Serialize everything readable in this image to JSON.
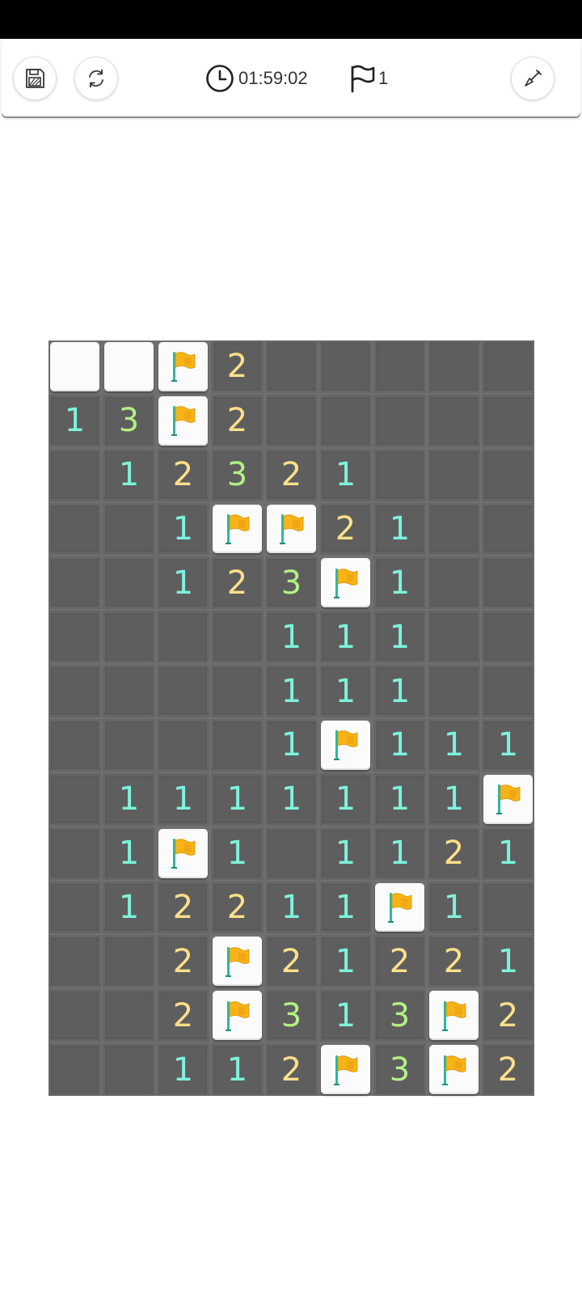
{
  "toolbar": {
    "save_icon": "save-icon",
    "restart_icon": "restart-icon",
    "timer_icon": "clock-icon",
    "timer": "01:59:02",
    "flag_icon": "flag-icon",
    "flag_count": "1",
    "dig_icon": "shovel-icon"
  },
  "colors": {
    "n1": "#7ef3dd",
    "n2": "#ffe08a",
    "n3": "#b4f184",
    "flag": "#f7b318",
    "flag_pole": "#2bb8a0",
    "open_cell": "#5e5e5e",
    "hidden_cell": "#fbfbfb"
  },
  "board": {
    "columns": 9,
    "rows_count": 14,
    "legend": "H = unrevealed tile, F = flagged tile, E = revealed empty, digit = revealed number",
    "rows": [
      [
        "H",
        "H",
        "F",
        "2",
        "E",
        "E",
        "E",
        "E",
        "E"
      ],
      [
        "1",
        "3",
        "F",
        "2",
        "E",
        "E",
        "E",
        "E",
        "E"
      ],
      [
        "E",
        "1",
        "2",
        "3",
        "2",
        "1",
        "E",
        "E",
        "E"
      ],
      [
        "E",
        "E",
        "1",
        "F",
        "F",
        "2",
        "1",
        "E",
        "E"
      ],
      [
        "E",
        "E",
        "1",
        "2",
        "3",
        "F",
        "1",
        "E",
        "E"
      ],
      [
        "E",
        "E",
        "E",
        "E",
        "1",
        "1",
        "1",
        "E",
        "E"
      ],
      [
        "E",
        "E",
        "E",
        "E",
        "1",
        "1",
        "1",
        "E",
        "E"
      ],
      [
        "E",
        "E",
        "E",
        "E",
        "1",
        "F",
        "1",
        "1",
        "1"
      ],
      [
        "E",
        "1",
        "1",
        "1",
        "1",
        "1",
        "1",
        "1",
        "F"
      ],
      [
        "E",
        "1",
        "F",
        "1",
        "E",
        "1",
        "1",
        "2",
        "1"
      ],
      [
        "E",
        "1",
        "2",
        "2",
        "1",
        "1",
        "F",
        "1",
        "E"
      ],
      [
        "E",
        "E",
        "2",
        "F",
        "2",
        "1",
        "2",
        "2",
        "1"
      ],
      [
        "E",
        "E",
        "2",
        "F",
        "3",
        "1",
        "3",
        "F",
        "2"
      ],
      [
        "E",
        "E",
        "1",
        "1",
        "2",
        "F",
        "3",
        "F",
        "2"
      ]
    ]
  }
}
